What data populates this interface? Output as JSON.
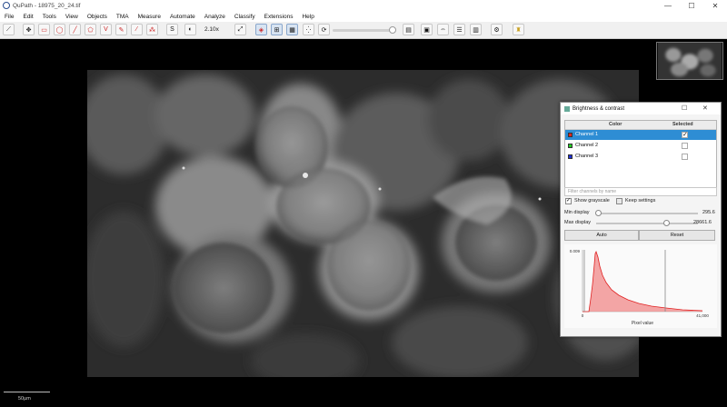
{
  "window": {
    "title": "QuPath - 18975_20_24.tif",
    "minimize": "—",
    "maximize": "☐",
    "close": "✕"
  },
  "menu": [
    "File",
    "Edit",
    "Tools",
    "View",
    "Objects",
    "TMA",
    "Measure",
    "Automate",
    "Analyze",
    "Classify",
    "Extensions",
    "Help"
  ],
  "toolbar": {
    "zoom": "2.10x"
  },
  "scalebar": {
    "label": "50µm"
  },
  "dialog": {
    "title": "Brightness & contrast",
    "columns": {
      "color": "Color",
      "selected": "Selected"
    },
    "channels": [
      {
        "name": "Channel 1",
        "color": "#e0261f",
        "checked": true,
        "selected_row": true
      },
      {
        "name": "Channel 2",
        "color": "#22cc22",
        "checked": false,
        "selected_row": false
      },
      {
        "name": "Channel 3",
        "color": "#1f2fd6",
        "checked": false,
        "selected_row": false
      }
    ],
    "filter_placeholder": "Filter channels by name",
    "show_grayscale": {
      "label": "Show grayscale",
      "checked": true
    },
    "keep_settings": {
      "label": "Keep settings",
      "checked": false
    },
    "min_display": {
      "label": "Min display",
      "value": "295.6",
      "fraction": 0.02
    },
    "max_display": {
      "label": "Max display",
      "value": "28661.6",
      "fraction": 0.69
    },
    "auto_label": "Auto",
    "reset_label": "Reset",
    "histogram": {
      "y_top": "0.009",
      "x_min": "0",
      "x_max": "41,000",
      "xlabel": "Pixel value"
    }
  },
  "colors": {
    "accent": "#2e8dd4",
    "histogram_fill": "#f08080",
    "histogram_line": "#e02020"
  }
}
